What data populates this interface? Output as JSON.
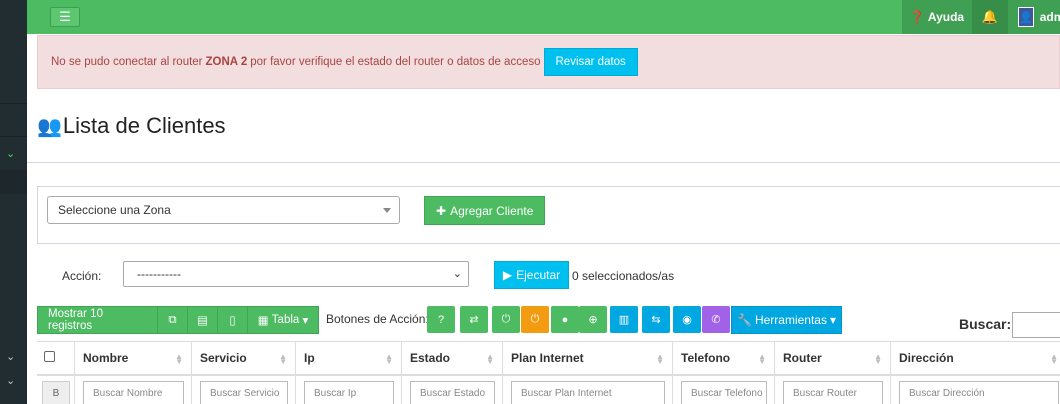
{
  "navbar": {
    "toggle_icon": "hamburger-icon",
    "help_label": "Ayuda",
    "user_label": "admin"
  },
  "alert": {
    "text_before": "No se pudo conectar al router",
    "router_name": "ZONA 2",
    "text_after": "por favor verifique el estado del router o datos de acceso",
    "button_label": "Revisar datos"
  },
  "header": {
    "title": "Lista de Clientes",
    "icon": "users-icon"
  },
  "zone": {
    "select_value": "Seleccione una Zona",
    "add_button_label": "Agregar Cliente"
  },
  "action": {
    "label": "Acción:",
    "select_value": "-----------",
    "execute_label": "Ejecutar",
    "selected_count_text": "0 seleccionados/as"
  },
  "toolbar": {
    "show_records_label": "Mostrar 10 registros",
    "table_label": "Tabla",
    "action_buttons_label": "Botones de Acción:",
    "tools_label": "Herramientas",
    "search_label": "Buscar:",
    "action_buttons": [
      {
        "icon": "question-icon",
        "glyph": "?",
        "color": "#4cbb61"
      },
      {
        "icon": "retweet-icon",
        "glyph": "⇄",
        "color": "#4cbb61"
      },
      {
        "icon": "power-icon",
        "glyph": "⏻",
        "color": "#4cbb61"
      },
      {
        "icon": "power-icon",
        "glyph": "⏻",
        "color": "#f39c12"
      },
      {
        "icon": "user-icon",
        "glyph": "●",
        "color": "#4cbb61"
      },
      {
        "icon": "globe-icon",
        "glyph": "⊕",
        "color": "#4cbb61"
      },
      {
        "icon": "bar-chart-icon",
        "glyph": "▥",
        "color": "#00a7e1"
      },
      {
        "icon": "exchange-icon",
        "glyph": "⇆",
        "color": "#00a7e1"
      },
      {
        "icon": "globe-alt-icon",
        "glyph": "◉",
        "color": "#00a7e1"
      },
      {
        "icon": "phone-icon",
        "glyph": "✆",
        "color": "#a162e8"
      }
    ]
  },
  "table": {
    "columns": [
      "Nombre",
      "Servicio",
      "Ip",
      "Estado",
      "Plan Internet",
      "Telefono",
      "Router",
      "Dirección"
    ],
    "search_placeholders": [
      "Buscar Nombre",
      "Buscar Servicio",
      "Buscar Ip",
      "Buscar Estado",
      "Buscar Plan Internet",
      "Buscar Telefono",
      "Buscar Router",
      "Buscar Dirección"
    ],
    "row_button_label": "B"
  }
}
